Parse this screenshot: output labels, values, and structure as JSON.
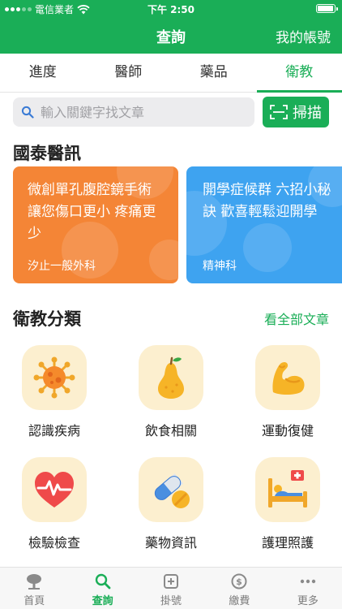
{
  "status_bar": {
    "carrier": "電信業者",
    "time": "下午 2:50"
  },
  "header": {
    "title": "查詢",
    "account": "我的帳號"
  },
  "tabs": [
    {
      "label": "進度"
    },
    {
      "label": "醫師"
    },
    {
      "label": "藥品"
    },
    {
      "label": "衛教",
      "active": true
    }
  ],
  "search": {
    "placeholder": "輸入關鍵字找文章",
    "value": "",
    "scan_label": "掃描"
  },
  "news": {
    "title": "國泰醫訊",
    "articles": [
      {
        "title": "微創單孔腹腔鏡手術讓您傷口更小 疼痛更少",
        "department": "汐止一般外科",
        "color": "#f48536"
      },
      {
        "title": "開學症候群 六招小秘訣 歡喜輕鬆迎開學",
        "department": "精神科",
        "color": "#3ea3f0"
      }
    ]
  },
  "categories": {
    "title": "衛教分類",
    "see_all": "看全部文章",
    "items": [
      {
        "label": "認識疾病",
        "icon": "virus-icon"
      },
      {
        "label": "飲食相關",
        "icon": "pear-icon"
      },
      {
        "label": "運動復健",
        "icon": "flexed-bicep-icon"
      },
      {
        "label": "檢驗檢查",
        "icon": "heart-pulse-icon"
      },
      {
        "label": "藥物資訊",
        "icon": "pills-icon"
      },
      {
        "label": "護理照護",
        "icon": "hospital-bed-icon"
      }
    ]
  },
  "bottom_nav": [
    {
      "label": "首頁",
      "icon": "tree-icon"
    },
    {
      "label": "查詢",
      "icon": "search-icon",
      "active": true
    },
    {
      "label": "掛號",
      "icon": "register-plus-icon"
    },
    {
      "label": "繳費",
      "icon": "dollar-icon"
    },
    {
      "label": "更多",
      "icon": "more-dots-icon"
    }
  ],
  "colors": {
    "brand_green": "#1aae57",
    "tile_bg": "#fcefcf"
  }
}
